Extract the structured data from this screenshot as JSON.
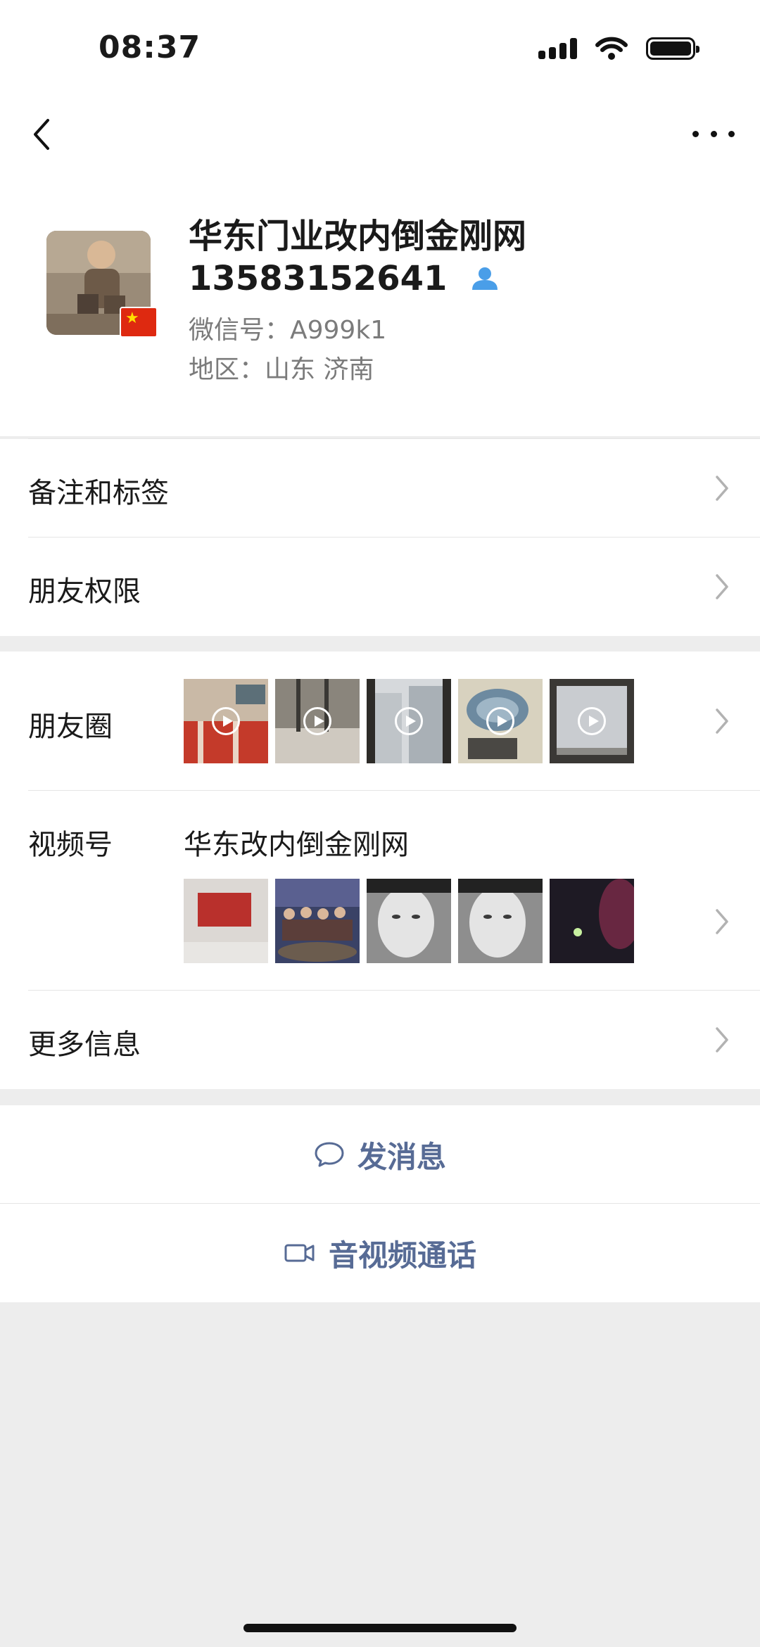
{
  "status_bar": {
    "time": "08:37"
  },
  "profile": {
    "name": "华东门业改内倒金刚网",
    "phone": "13583152641",
    "wechat_id": "微信号：A999k1",
    "region": "地区：山东 济南",
    "flag_icon": "china-flag-icon"
  },
  "menu": {
    "remarks_tags": "备注和标签",
    "friend_permissions": "朋友权限",
    "moments": "朋友圈",
    "channels": "视频号",
    "channels_name": "华东改内倒金刚网",
    "more_info": "更多信息"
  },
  "actions": {
    "send_message": "发消息",
    "av_call": "音视频通话"
  },
  "colors": {
    "link": "#576b95",
    "background": "#ededed",
    "contact_icon": "#4a9ee8"
  }
}
